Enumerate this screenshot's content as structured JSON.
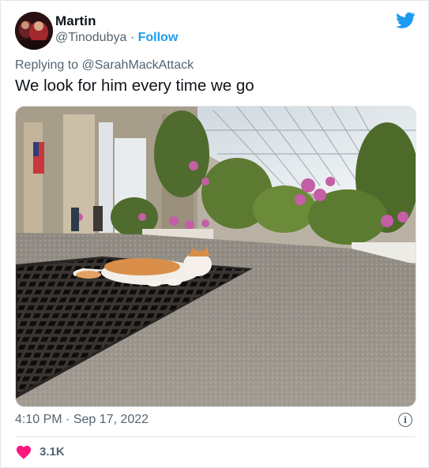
{
  "author": {
    "name": "Martin",
    "handle": "@Tinodubya",
    "separator": "·",
    "follow_label": "Follow"
  },
  "reply": {
    "prefix": "Replying to",
    "mention": "@SarahMackAttack"
  },
  "tweet": {
    "text": "We look for him every time we go"
  },
  "meta": {
    "time": "4:10 PM",
    "separator": "·",
    "date": "Sep 17, 2022"
  },
  "engagement": {
    "likes": "3.1K"
  },
  "icons": {
    "brand": "twitter-bird-icon",
    "info": "info-icon",
    "like": "heart-icon"
  },
  "colors": {
    "brand": "#1d9bf0",
    "like": "#f91880",
    "secondary_text": "#536471",
    "text": "#0f1419"
  }
}
